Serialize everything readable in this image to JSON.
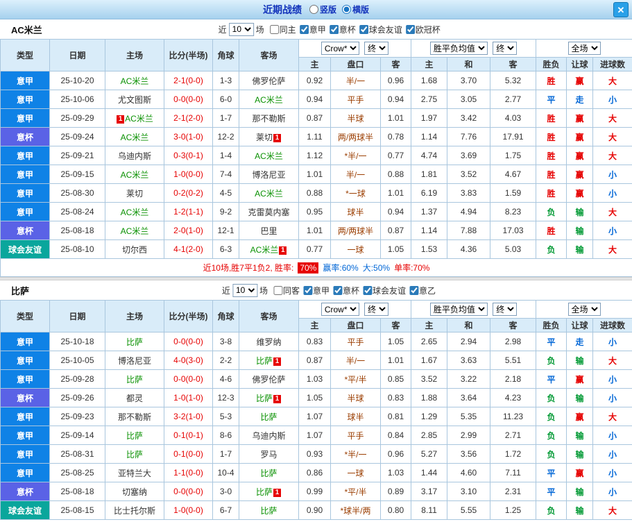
{
  "colors": {
    "type": {
      "意甲": "#0f82e6",
      "意杯": "#5a62e6",
      "球会友谊": "#0aa69c"
    },
    "result": {
      "胜": "#e60000",
      "赢": "#e60000",
      "大": "#e60000",
      "平": "#0066d6",
      "走": "#0066d6",
      "小": "#0066d6",
      "负": "#009933",
      "输": "#009933"
    },
    "team_highlight": "#089000",
    "score": "#e60000"
  },
  "titlebar": {
    "title": "近期战绩",
    "radios": [
      {
        "label": "竖版",
        "checked": false
      },
      {
        "label": "横版",
        "checked": true
      }
    ],
    "close": "✕"
  },
  "table_head": {
    "cols": [
      "类型",
      "日期",
      "主场",
      "比分(半场)",
      "角球",
      "客场"
    ],
    "group1": {
      "select1": "Crow*",
      "select2": "终"
    },
    "group2": {
      "select1": "胜平负均值",
      "select2": "终"
    },
    "group3": {
      "select": "全场"
    },
    "sub": [
      "主",
      "盘口",
      "客",
      "主",
      "和",
      "客",
      "胜负",
      "让球",
      "进球数"
    ]
  },
  "sections": [
    {
      "team": "AC米兰",
      "near_label": "近",
      "count": "10",
      "games_label": "场",
      "filters": [
        {
          "label": "同主",
          "checked": false
        },
        {
          "label": "意甲",
          "checked": true
        },
        {
          "label": "意杯",
          "checked": true
        },
        {
          "label": "球会友谊",
          "checked": true
        },
        {
          "label": "欧冠杯",
          "checked": true
        }
      ],
      "rows": [
        {
          "type": "意甲",
          "date": "25-10-20",
          "home": {
            "name": "AC米兰",
            "hl": true
          },
          "score": "2-1(0-0)",
          "corner": "1-3",
          "away": {
            "name": "佛罗伦萨"
          },
          "vals": [
            "0.92",
            "半/一",
            "0.96",
            "1.68",
            "3.70",
            "5.32"
          ],
          "res": [
            "胜",
            "赢",
            "大"
          ]
        },
        {
          "type": "意甲",
          "date": "25-10-06",
          "home": {
            "name": "尤文图斯"
          },
          "score": "0-0(0-0)",
          "corner": "6-0",
          "away": {
            "name": "AC米兰",
            "hl": true
          },
          "vals": [
            "0.94",
            "平手",
            "0.94",
            "2.75",
            "3.05",
            "2.77"
          ],
          "res": [
            "平",
            "走",
            "小"
          ]
        },
        {
          "type": "意甲",
          "date": "25-09-29",
          "home": {
            "name": "AC米兰",
            "hl": true,
            "badge": "1",
            "badge_pos": "before"
          },
          "score": "2-1(2-0)",
          "corner": "1-7",
          "away": {
            "name": "那不勒斯"
          },
          "vals": [
            "0.87",
            "半球",
            "1.01",
            "1.97",
            "3.42",
            "4.03"
          ],
          "res": [
            "胜",
            "赢",
            "大"
          ]
        },
        {
          "type": "意杯",
          "date": "25-09-24",
          "home": {
            "name": "AC米兰",
            "hl": true
          },
          "score": "3-0(1-0)",
          "corner": "12-2",
          "away": {
            "name": "莱切",
            "badge": "1",
            "badge_pos": "after"
          },
          "vals": [
            "1.11",
            "两/两球半",
            "0.78",
            "1.14",
            "7.76",
            "17.91"
          ],
          "res": [
            "胜",
            "赢",
            "大"
          ]
        },
        {
          "type": "意甲",
          "date": "25-09-21",
          "home": {
            "name": "乌迪内斯"
          },
          "score": "0-3(0-1)",
          "corner": "1-4",
          "away": {
            "name": "AC米兰",
            "hl": true
          },
          "vals": [
            "1.12",
            "*半/一",
            "0.77",
            "4.74",
            "3.69",
            "1.75"
          ],
          "res": [
            "胜",
            "赢",
            "大"
          ]
        },
        {
          "type": "意甲",
          "date": "25-09-15",
          "home": {
            "name": "AC米兰",
            "hl": true
          },
          "score": "1-0(0-0)",
          "corner": "7-4",
          "away": {
            "name": "博洛尼亚"
          },
          "vals": [
            "1.01",
            "半/一",
            "0.88",
            "1.81",
            "3.52",
            "4.67"
          ],
          "res": [
            "胜",
            "赢",
            "小"
          ]
        },
        {
          "type": "意甲",
          "date": "25-08-30",
          "home": {
            "name": "莱切"
          },
          "score": "0-2(0-2)",
          "corner": "4-5",
          "away": {
            "name": "AC米兰",
            "hl": true
          },
          "vals": [
            "0.88",
            "*一球",
            "1.01",
            "6.19",
            "3.83",
            "1.59"
          ],
          "res": [
            "胜",
            "赢",
            "小"
          ]
        },
        {
          "type": "意甲",
          "date": "25-08-24",
          "home": {
            "name": "AC米兰",
            "hl": true
          },
          "score": "1-2(1-1)",
          "corner": "9-2",
          "away": {
            "name": "克雷莫内塞"
          },
          "vals": [
            "0.95",
            "球半",
            "0.94",
            "1.37",
            "4.94",
            "8.23"
          ],
          "res": [
            "负",
            "输",
            "大"
          ]
        },
        {
          "type": "意杯",
          "date": "25-08-18",
          "home": {
            "name": "AC米兰",
            "hl": true
          },
          "score": "2-0(1-0)",
          "corner": "12-1",
          "away": {
            "name": "巴里"
          },
          "vals": [
            "1.01",
            "两/两球半",
            "0.87",
            "1.14",
            "7.88",
            "17.03"
          ],
          "res": [
            "胜",
            "输",
            "小"
          ]
        },
        {
          "type": "球会友谊",
          "date": "25-08-10",
          "home": {
            "name": "切尔西"
          },
          "score": "4-1(2-0)",
          "corner": "6-3",
          "away": {
            "name": "AC米兰",
            "hl": true,
            "badge": "1",
            "badge_pos": "after"
          },
          "vals": [
            "0.77",
            "一球",
            "1.05",
            "1.53",
            "4.36",
            "5.03"
          ],
          "res": [
            "负",
            "输",
            "大"
          ]
        }
      ],
      "summary": [
        {
          "text": "近10场,胜7平1负2, 胜率:",
          "color": "#e60000",
          "badge": false
        },
        {
          "text": "70%",
          "color": "#e60000",
          "badge": true
        },
        {
          "text": "赢率:60%",
          "color": "#0066d6",
          "badge": false
        },
        {
          "text": "大:50%",
          "color": "#0066d6",
          "badge": false
        },
        {
          "text": "单率:70%",
          "color": "#e60000",
          "badge": false
        }
      ]
    },
    {
      "team": "比萨",
      "near_label": "近",
      "count": "10",
      "games_label": "场",
      "filters": [
        {
          "label": "同客",
          "checked": false
        },
        {
          "label": "意甲",
          "checked": true
        },
        {
          "label": "意杯",
          "checked": true
        },
        {
          "label": "球会友谊",
          "checked": true
        },
        {
          "label": "意乙",
          "checked": true
        }
      ],
      "rows": [
        {
          "type": "意甲",
          "date": "25-10-18",
          "home": {
            "name": "比萨",
            "hl": true
          },
          "score": "0-0(0-0)",
          "corner": "3-8",
          "away": {
            "name": "维罗纳"
          },
          "vals": [
            "0.83",
            "平手",
            "1.05",
            "2.65",
            "2.94",
            "2.98"
          ],
          "res": [
            "平",
            "走",
            "小"
          ]
        },
        {
          "type": "意甲",
          "date": "25-10-05",
          "home": {
            "name": "博洛尼亚"
          },
          "score": "4-0(3-0)",
          "corner": "2-2",
          "away": {
            "name": "比萨",
            "hl": true,
            "badge": "1",
            "badge_pos": "after"
          },
          "vals": [
            "0.87",
            "半/一",
            "1.01",
            "1.67",
            "3.63",
            "5.51"
          ],
          "res": [
            "负",
            "输",
            "大"
          ]
        },
        {
          "type": "意甲",
          "date": "25-09-28",
          "home": {
            "name": "比萨",
            "hl": true
          },
          "score": "0-0(0-0)",
          "corner": "4-6",
          "away": {
            "name": "佛罗伦萨"
          },
          "vals": [
            "1.03",
            "*平/半",
            "0.85",
            "3.52",
            "3.22",
            "2.18"
          ],
          "res": [
            "平",
            "赢",
            "小"
          ]
        },
        {
          "type": "意杯",
          "date": "25-09-26",
          "home": {
            "name": "都灵"
          },
          "score": "1-0(1-0)",
          "corner": "12-3",
          "away": {
            "name": "比萨",
            "hl": true,
            "badge": "1",
            "badge_pos": "after"
          },
          "vals": [
            "1.05",
            "半球",
            "0.83",
            "1.88",
            "3.64",
            "4.23"
          ],
          "res": [
            "负",
            "输",
            "小"
          ]
        },
        {
          "type": "意甲",
          "date": "25-09-23",
          "home": {
            "name": "那不勒斯"
          },
          "score": "3-2(1-0)",
          "corner": "5-3",
          "away": {
            "name": "比萨",
            "hl": true
          },
          "vals": [
            "1.07",
            "球半",
            "0.81",
            "1.29",
            "5.35",
            "11.23"
          ],
          "res": [
            "负",
            "赢",
            "大"
          ]
        },
        {
          "type": "意甲",
          "date": "25-09-14",
          "home": {
            "name": "比萨",
            "hl": true
          },
          "score": "0-1(0-1)",
          "corner": "8-6",
          "away": {
            "name": "乌迪内斯"
          },
          "vals": [
            "1.07",
            "平手",
            "0.84",
            "2.85",
            "2.99",
            "2.71"
          ],
          "res": [
            "负",
            "输",
            "小"
          ]
        },
        {
          "type": "意甲",
          "date": "25-08-31",
          "home": {
            "name": "比萨",
            "hl": true
          },
          "score": "0-1(0-0)",
          "corner": "1-7",
          "away": {
            "name": "罗马"
          },
          "vals": [
            "0.93",
            "*半/一",
            "0.96",
            "5.27",
            "3.56",
            "1.72"
          ],
          "res": [
            "负",
            "输",
            "小"
          ]
        },
        {
          "type": "意甲",
          "date": "25-08-25",
          "home": {
            "name": "亚特兰大"
          },
          "score": "1-1(0-0)",
          "corner": "10-4",
          "away": {
            "name": "比萨",
            "hl": true
          },
          "vals": [
            "0.86",
            "一球",
            "1.03",
            "1.44",
            "4.60",
            "7.11"
          ],
          "res": [
            "平",
            "赢",
            "小"
          ]
        },
        {
          "type": "意杯",
          "date": "25-08-18",
          "home": {
            "name": "切塞纳"
          },
          "score": "0-0(0-0)",
          "corner": "3-0",
          "away": {
            "name": "比萨",
            "hl": true,
            "badge": "1",
            "badge_pos": "after"
          },
          "vals": [
            "0.99",
            "*平/半",
            "0.89",
            "3.17",
            "3.10",
            "2.31"
          ],
          "res": [
            "平",
            "输",
            "小"
          ]
        },
        {
          "type": "球会友谊",
          "date": "25-08-15",
          "home": {
            "name": "比士托尔斯"
          },
          "score": "1-0(0-0)",
          "corner": "6-7",
          "away": {
            "name": "比萨",
            "hl": true
          },
          "vals": [
            "0.90",
            "*球半/两",
            "0.80",
            "8.11",
            "5.55",
            "1.25"
          ],
          "res": [
            "负",
            "输",
            "大"
          ]
        }
      ]
    }
  ]
}
